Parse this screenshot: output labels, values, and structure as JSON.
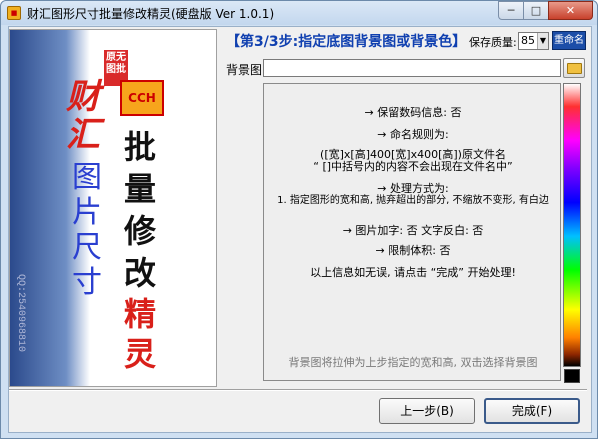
{
  "window": {
    "title": "财汇图形尺寸批量修改精灵(硬盘版 Ver 1.0.1)",
    "min_label": "─",
    "max_label": "□",
    "close_label": "✕"
  },
  "banner": {
    "logo_box": "原无图批",
    "logo_cch": "CCH",
    "brand": "财汇",
    "blue_text": "图片尺寸",
    "dark_text": "批量修改",
    "red_text": "精灵",
    "qq": "QQ:2540968810"
  },
  "step": {
    "title": "【第3/3步:指定底图背景图或背景色】",
    "quality_label": "保存质量:",
    "quality_value": "85",
    "rename_button": "重命名"
  },
  "background": {
    "label": "背景图:",
    "value": ""
  },
  "info": {
    "lines": [
      "→  保留数码信息: 否",
      "→  命名规则为:",
      "([宽]x[高]400[宽]x400[高])原文件名",
      "“ []中括号内的内容不会出现在文件名中”",
      "→  处理方式为:",
      "1. 指定图形的宽和高, 抛弃超出的部分, 不缩放不变形, 有白边",
      "→  图片加字: 否    文字反白: 否",
      "→  限制体积: 否",
      "以上信息如无误, 请点击 “完成” 开始处理!"
    ],
    "hint": "背景图将拉伸为上步指定的宽和高, 双击选择背景图"
  },
  "buttons": {
    "prev": "上一步(B)",
    "finish": "完成(F)"
  },
  "colors": {
    "title_blue": "#1040b0",
    "rename_bg": "#1c4ea8",
    "brand_red": "#d9201a"
  }
}
